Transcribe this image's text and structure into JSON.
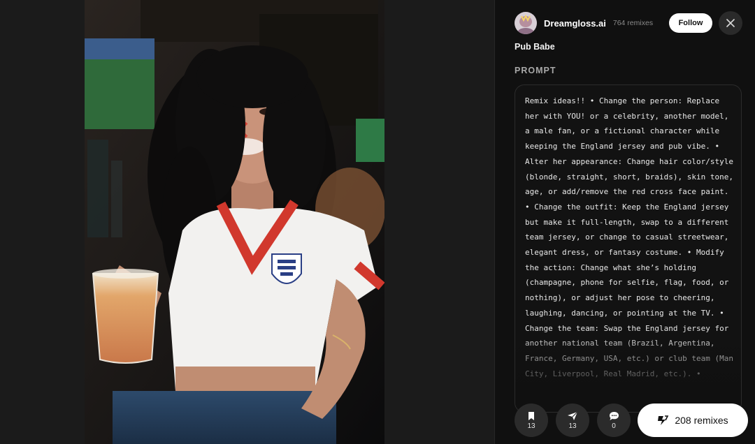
{
  "user": {
    "name": "Dreamgloss.ai",
    "remixes": "764 remixes"
  },
  "header": {
    "follow_label": "Follow"
  },
  "post": {
    "title": "Pub Babe",
    "section_label": "PROMPT",
    "prompt": "Remix ideas!! • Change the person: Replace her with YOU! or a celebrity, another model, a male fan, or a fictional character while keeping the England jersey and pub vibe. • Alter her appearance: Change hair color/style (blonde, straight, short, braids), skin tone, age, or add/remove the red cross face paint. • Change the outfit: Keep the England jersey but make it full-length, swap to a different team jersey, or change to casual streetwear, elegant dress, or fantasy costume. • Modify the action: Change what she’s holding (champagne, phone for selfie, flag, food, or nothing), or adjust her pose to cheering, laughing, dancing, or pointing at the TV. • Change the team: Swap the England jersey for another national team (Brazil, Argentina, France, Germany, USA, etc.) or club team (Man City, Liverpool, Real Madrid, etc.). •"
  },
  "actions": {
    "bookmark_count": "13",
    "share_count": "13",
    "comment_count": "0",
    "remix_label": "208 remixes"
  },
  "icons": {
    "close": "close-icon",
    "bookmark": "bookmark-icon",
    "share": "send-icon",
    "comment": "comment-icon",
    "remix": "remix-icon"
  },
  "colors": {
    "panel_bg": "#101010",
    "viewer_bg": "#1b1b1b",
    "accent_button": "#ffffff",
    "muted_text": "#8a8a8a"
  }
}
